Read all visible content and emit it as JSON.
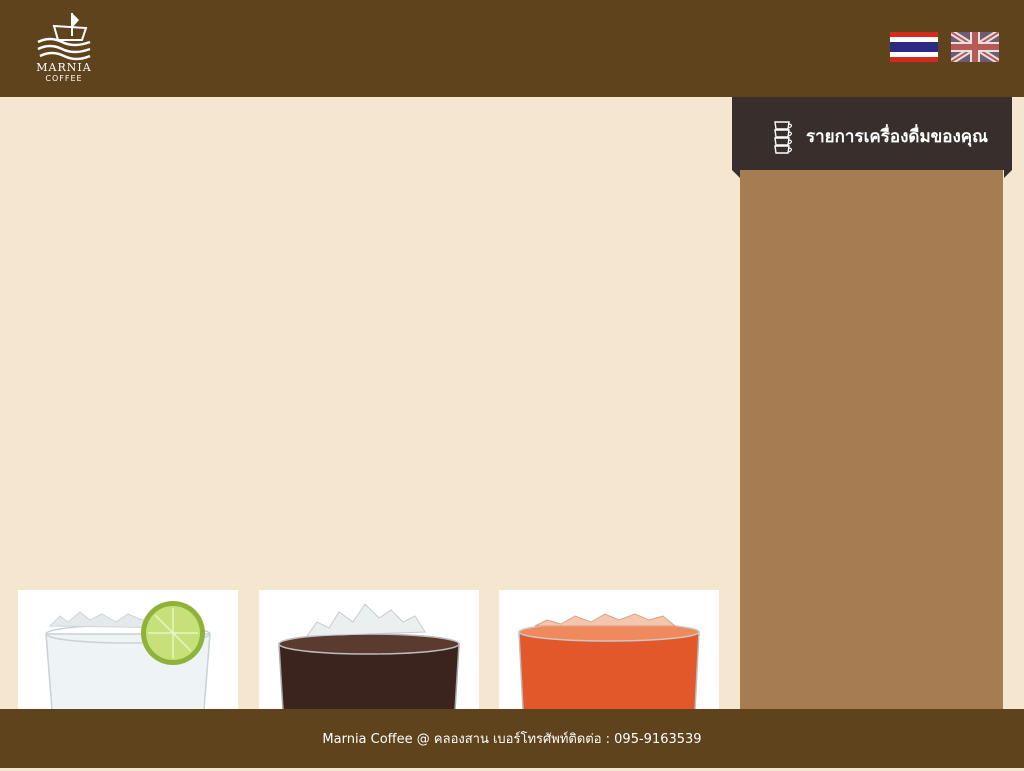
{
  "brand": {
    "name": "MARNIA",
    "subtitle": "COFFEE"
  },
  "languages": [
    {
      "code": "th",
      "icon": "thailand-flag-icon"
    },
    {
      "code": "en",
      "icon": "uk-flag-icon"
    }
  ],
  "cart": {
    "title": "รายการเครื่องดื่มของคุณ",
    "icon": "stacked-cups-icon"
  },
  "products": [
    {
      "icon": "iced-soda-lime-image"
    },
    {
      "icon": "iced-cola-image"
    },
    {
      "icon": "iced-tea-image"
    }
  ],
  "footer": {
    "text": "Marnia Coffee @ คลองสาน  เบอร์โทรศัพท์ติดต่อ : 095-9163539"
  },
  "colors": {
    "header": "#5e431d",
    "background": "#f5e6cf",
    "cart_header": "#382f2c",
    "cart_panel": "#a67c52"
  }
}
